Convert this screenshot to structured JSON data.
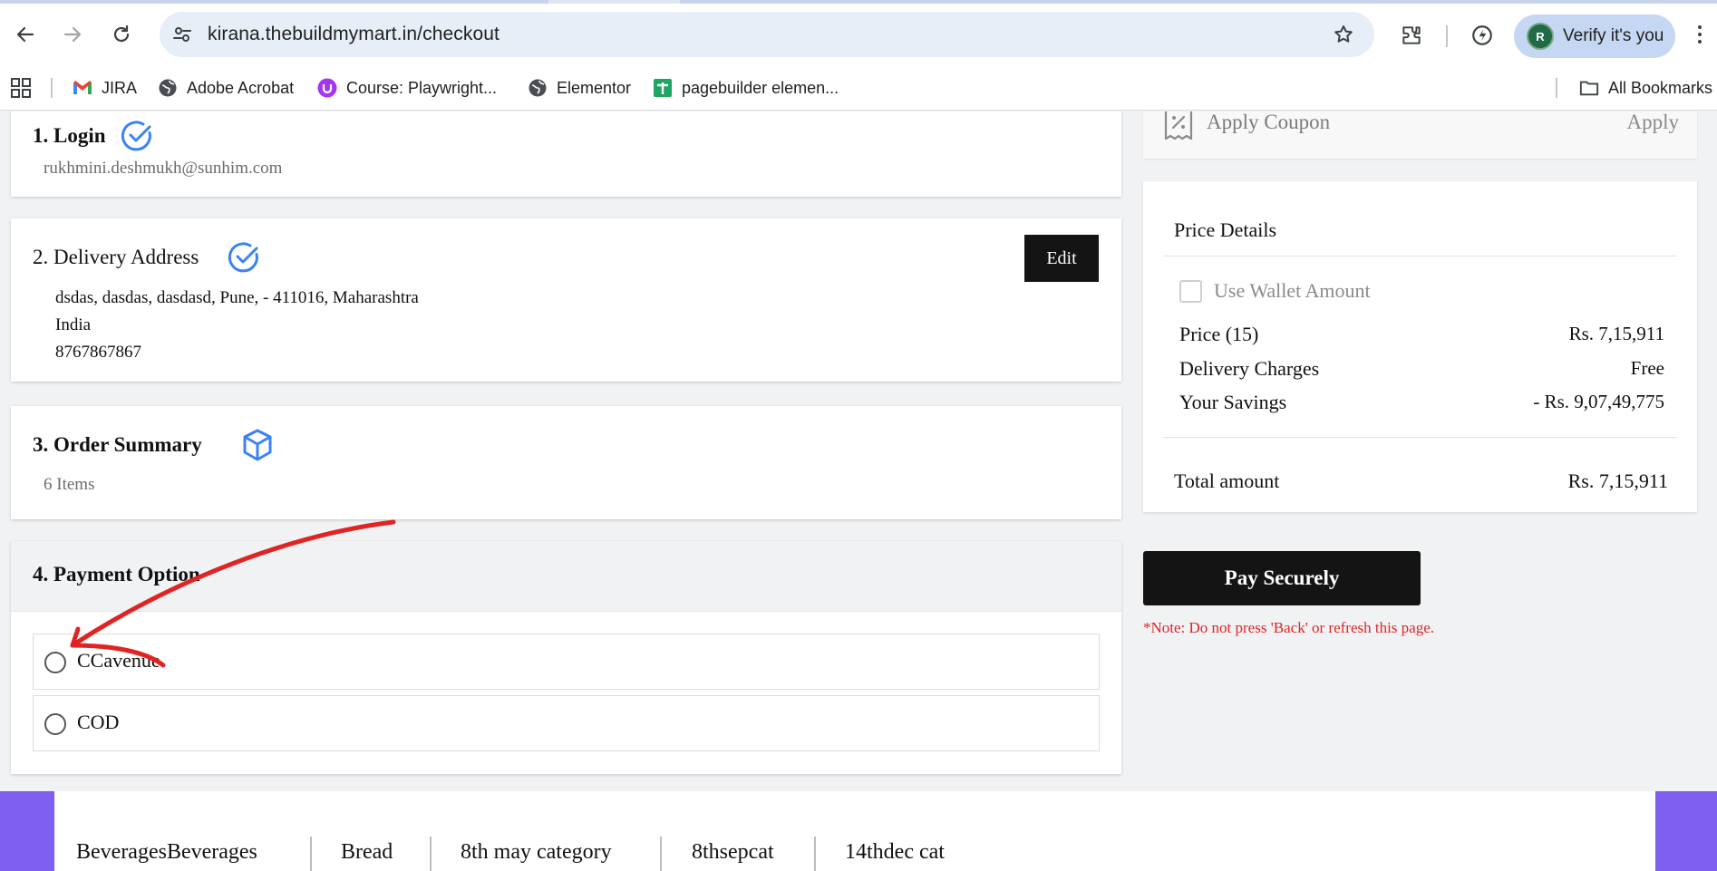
{
  "browser": {
    "url": "kirana.thebuildmymart.in/checkout",
    "verify_label": "Verify it's you",
    "avatar_initial": "R",
    "bookmarks": [
      {
        "label": "JIRA",
        "icon": "gmail-icon"
      },
      {
        "label": "Adobe Acrobat",
        "icon": "globe-icon"
      },
      {
        "label": "Course: Playwright...",
        "icon": "udemy-icon"
      },
      {
        "label": "Elementor",
        "icon": "globe-icon"
      },
      {
        "label": "pagebuilder elemen...",
        "icon": "sheets-icon"
      }
    ],
    "all_bookmarks": "All Bookmarks"
  },
  "checkout": {
    "login": {
      "title": "1. Login",
      "email": "rukhmini.deshmukh@sunhim.com"
    },
    "delivery": {
      "title": "2. Delivery Address",
      "line1": "dsdas, dasdas, dasdasd, Pune, - 411016, Maharashtra",
      "line2": "India",
      "phone": "8767867867",
      "edit_label": "Edit"
    },
    "order_summary": {
      "title": "3. Order Summary",
      "items": "6 Items"
    },
    "payment": {
      "title": "4. Payment Option",
      "options": [
        {
          "label": "CCavenue"
        },
        {
          "label": "COD"
        }
      ]
    }
  },
  "coupon": {
    "label": "Apply Coupon",
    "action": "Apply"
  },
  "price_details": {
    "title": "Price Details",
    "wallet_label": "Use Wallet Amount",
    "rows": [
      {
        "label": "Price (15)",
        "value": "Rs. 7,15,911"
      },
      {
        "label": "Delivery Charges",
        "value": "Free"
      },
      {
        "label": "Your Savings",
        "value": "- Rs. 9,07,49,775"
      }
    ],
    "total_label": "Total amount",
    "total_value": "Rs. 7,15,911"
  },
  "pay_button": "Pay Securely",
  "note": "*Note: Do not press 'Back' or refresh this page.",
  "categories": [
    "BeveragesBeverages",
    "Bread",
    "8th may category",
    "8thsepcat",
    "14thdec cat"
  ],
  "colors": {
    "accent_blue": "#3b82f6",
    "annotation_red": "#e02424",
    "footer_purple": "#7f5ff0",
    "dark_button": "#141414"
  }
}
